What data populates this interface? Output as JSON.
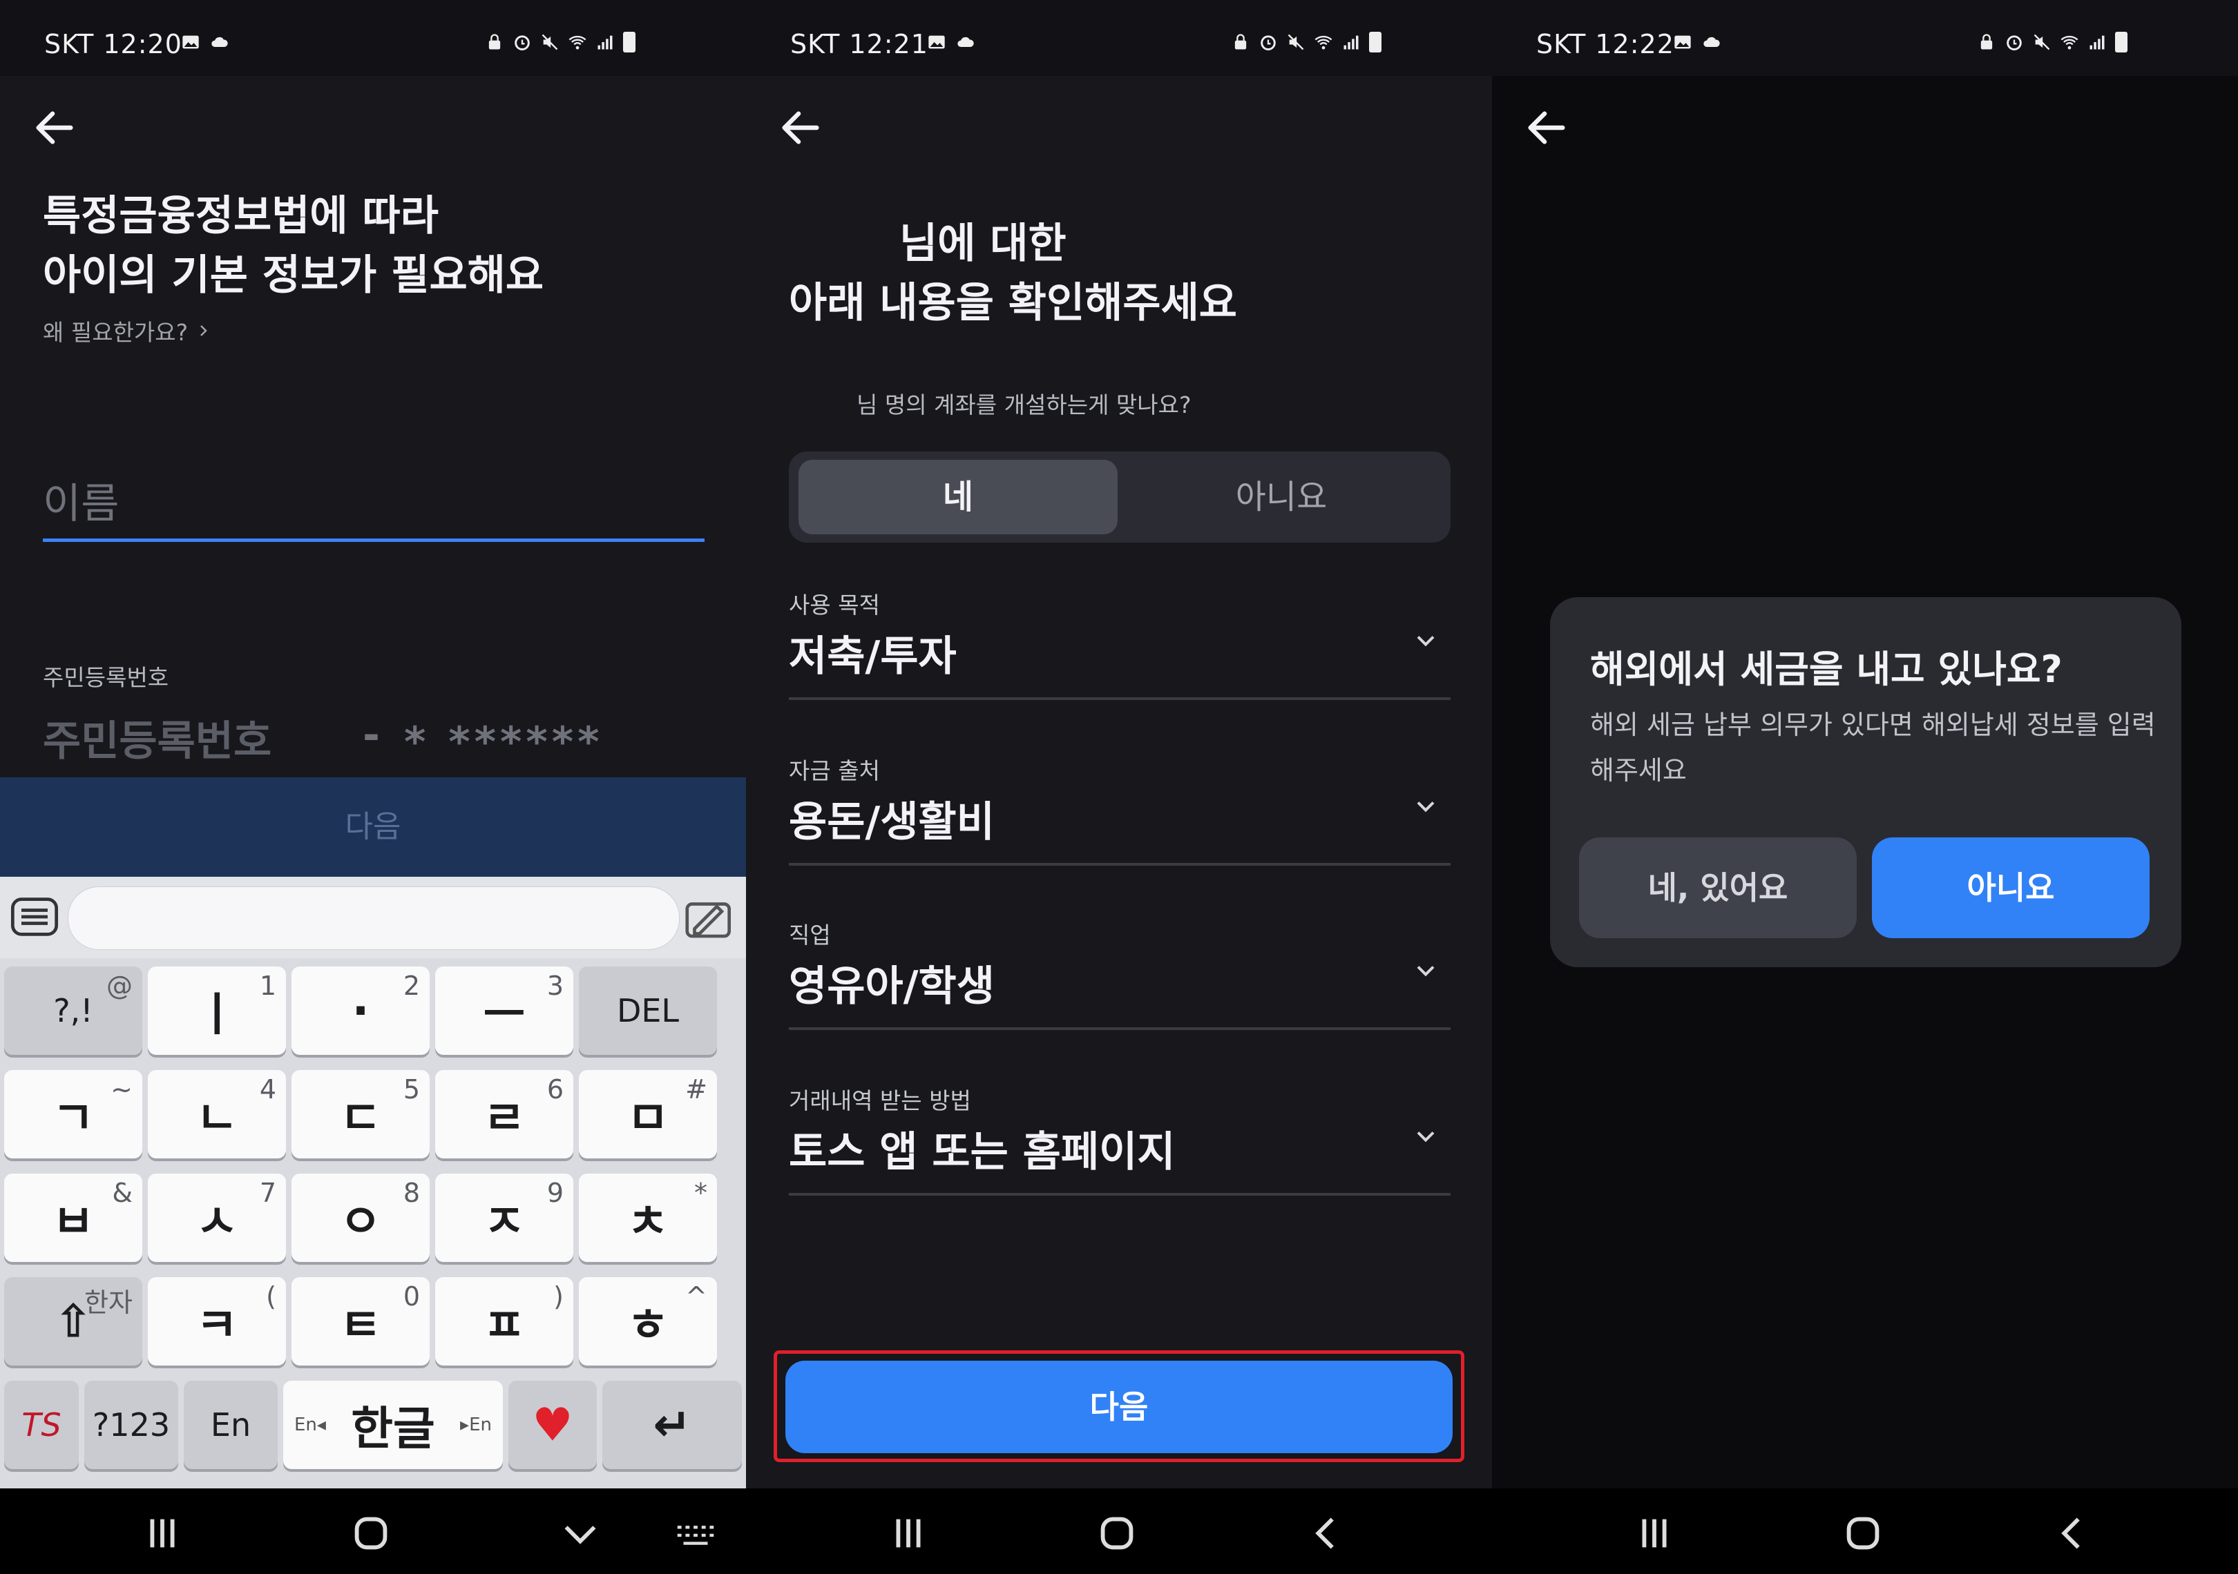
{
  "panel1": {
    "status": {
      "carrier": "SKT 12:20"
    },
    "title_line1": "특정금융정보법에 따라",
    "title_line2": "아이의 기본 정보가 필요해요",
    "why_link": "왜 필요한가요?",
    "name_placeholder": "이름",
    "id_label": "주민등록번호",
    "id_placeholder": "주민등록번호",
    "id_dash": "-",
    "id_mask": "* ******",
    "next_button": "다음",
    "keyboard": {
      "row1": [
        {
          "main": "?,!",
          "sub": "@"
        },
        {
          "main": "ㅣ",
          "sub": "1"
        },
        {
          "main": "·",
          "sub": "2"
        },
        {
          "main": "ㅡ",
          "sub": "3"
        },
        {
          "main": "DEL",
          "sub": ""
        }
      ],
      "row2": [
        {
          "main": "ㄱ",
          "sub": "~"
        },
        {
          "main": "ㄴ",
          "sub": "4"
        },
        {
          "main": "ㄷ",
          "sub": "5"
        },
        {
          "main": "ㄹ",
          "sub": "6"
        },
        {
          "main": "ㅁ",
          "sub": "#"
        }
      ],
      "row3": [
        {
          "main": "ㅂ",
          "sub": "&"
        },
        {
          "main": "ㅅ",
          "sub": "7"
        },
        {
          "main": "ㅇ",
          "sub": "8"
        },
        {
          "main": "ㅈ",
          "sub": "9"
        },
        {
          "main": "ㅊ",
          "sub": "*"
        }
      ],
      "row4": [
        {
          "main": "⇧",
          "sub": "한자"
        },
        {
          "main": "ㅋ",
          "sub": "("
        },
        {
          "main": "ㅌ",
          "sub": "0"
        },
        {
          "main": "ㅍ",
          "sub": ")"
        },
        {
          "main": "ㅎ",
          "sub": "^"
        }
      ],
      "row5": {
        "ts": "TS",
        "num": "?123",
        "en": "En",
        "space_main": "한글",
        "space_left": "En◂",
        "space_right": "▸En",
        "emoji": "♥",
        "enter": "↵"
      }
    }
  },
  "panel2": {
    "status": {
      "carrier": "SKT 12:21"
    },
    "title_line1": "님에 대한",
    "title_line2": "아래 내용을 확인해주세요",
    "question": "님 명의 계좌를 개설하는게 맞나요?",
    "seg_yes": "네",
    "seg_no": "아니요",
    "fields": [
      {
        "label": "사용 목적",
        "value": "저축/투자"
      },
      {
        "label": "자금 출처",
        "value": "용돈/생활비"
      },
      {
        "label": "직업",
        "value": "영유아/학생"
      },
      {
        "label": "거래내역 받는 방법",
        "value": "토스 앱 또는 홈페이지"
      }
    ],
    "next_button": "다음"
  },
  "panel3": {
    "status": {
      "carrier": "SKT 12:22"
    },
    "dialog_title": "해외에서 세금을 내고 있나요?",
    "dialog_body": "해외 세금 납부 의무가 있다면 해외납세 정보를 입력해주세요",
    "btn_yes": "네, 있어요",
    "btn_no": "아니요"
  },
  "colors": {
    "accent": "#3182f6",
    "background": "#17171c",
    "highlight_border": "#e0202a"
  }
}
